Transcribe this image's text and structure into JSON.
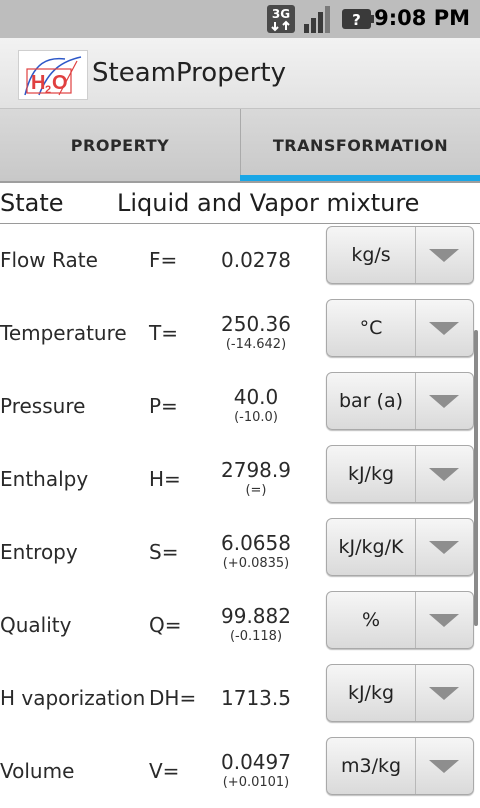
{
  "status_bar": {
    "network": "3G",
    "time": "9:08 PM",
    "icons": [
      "3g-data-icon",
      "signal-strength-icon",
      "battery-unknown-icon"
    ]
  },
  "app": {
    "title": "SteamProperty",
    "logo_text": "H2O"
  },
  "tabs": [
    {
      "label": "PROPERTY",
      "selected": false
    },
    {
      "label": "TRANSFORMATION",
      "selected": true
    }
  ],
  "state": {
    "label": "State",
    "value": "Liquid and Vapor mixture"
  },
  "properties": [
    {
      "name": "Flow Rate",
      "symbol": "F=",
      "value": "0.0278",
      "delta": "",
      "unit": "kg/s"
    },
    {
      "name": "Temperature",
      "symbol": "T=",
      "value": "250.36",
      "delta": "(-14.642)",
      "unit": "°C"
    },
    {
      "name": "Pressure",
      "symbol": "P=",
      "value": "40.0",
      "delta": "(-10.0)",
      "unit": "bar (a)"
    },
    {
      "name": "Enthalpy",
      "symbol": "H=",
      "value": "2798.9",
      "delta": "(=)",
      "unit": "kJ/kg"
    },
    {
      "name": "Entropy",
      "symbol": "S=",
      "value": "6.0658",
      "delta": "(+0.0835)",
      "unit": "kJ/kg/K"
    },
    {
      "name": "Quality",
      "symbol": "Q=",
      "value": "99.882",
      "delta": "(-0.118)",
      "unit": "%"
    },
    {
      "name": "H vaporization",
      "symbol": "DH=",
      "value": "1713.5",
      "delta": "",
      "unit": "kJ/kg"
    },
    {
      "name": "Volume",
      "symbol": "V=",
      "value": "0.0497",
      "delta": "(+0.0101)",
      "unit": "m3/kg"
    }
  ],
  "colors": {
    "tab_indicator": "#19a6e6",
    "status_bar": "#bdbdbd"
  }
}
